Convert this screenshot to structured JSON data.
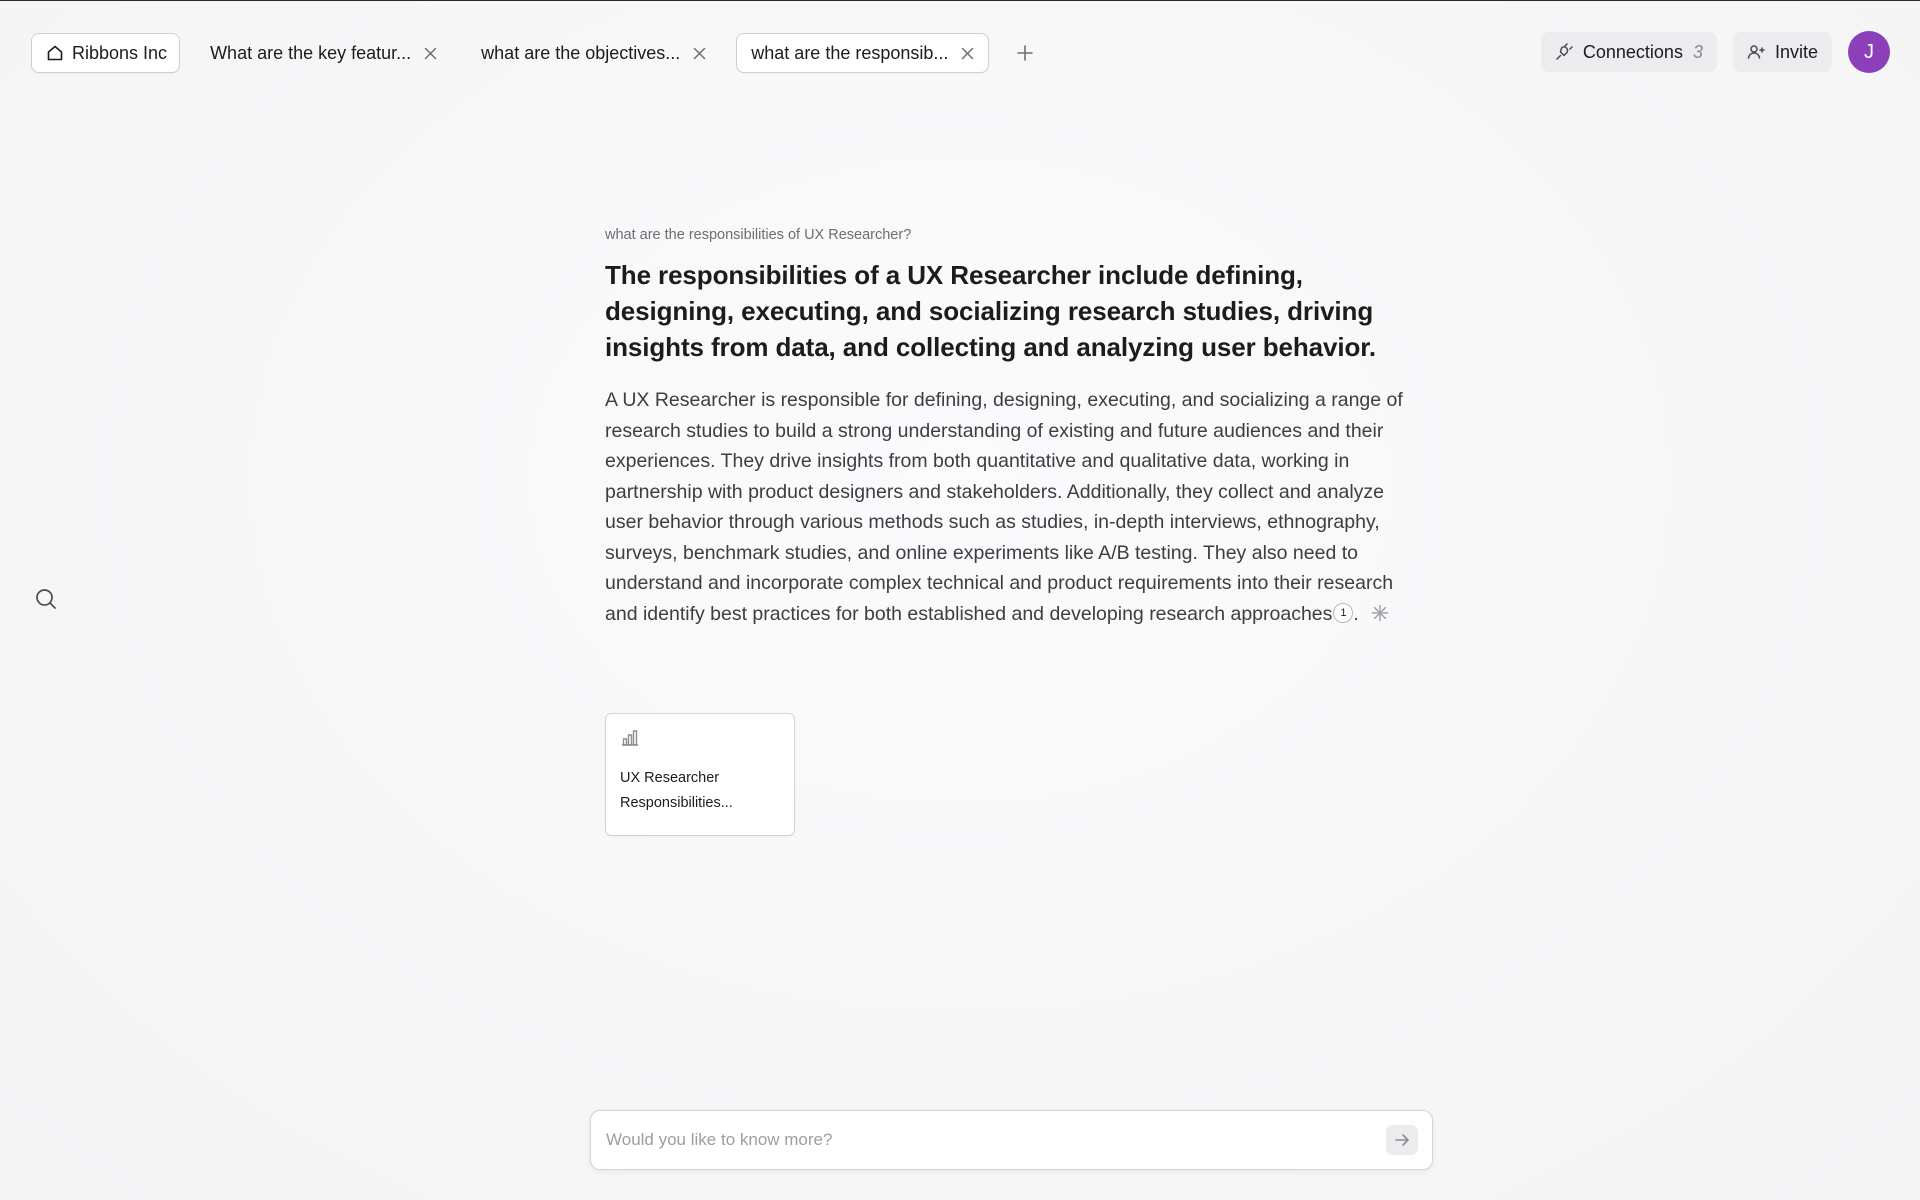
{
  "topbar": {
    "home_tab": {
      "label": "Ribbons Inc",
      "icon": "home-icon"
    },
    "tabs": [
      {
        "label": "What are the key featur...",
        "active": false
      },
      {
        "label": "what are the objectives...",
        "active": false
      },
      {
        "label": "what are the responsib...",
        "active": true
      }
    ],
    "new_tab_icon": "plus-icon",
    "connections": {
      "label": "Connections",
      "count": "3",
      "icon": "plug-icon"
    },
    "invite": {
      "label": "Invite",
      "icon": "user-plus-icon"
    },
    "avatar": {
      "initial": "J",
      "color": "#8b3fb8"
    }
  },
  "sidebar": {
    "search_icon": "search-icon"
  },
  "answer": {
    "question": "what are the responsibilities of UX Researcher?",
    "headline": "The responsibilities of a UX Researcher include defining, designing, executing, and socializing research studies, driving insights from data, and collecting and analyzing user behavior.",
    "body": "A UX Researcher is responsible for defining, designing, executing, and socializing a range of research studies to build a strong understanding of existing and future audiences and their experiences. They drive insights from both quantitative and qualitative data, working in partnership with product designers and stakeholders. Additionally, they collect and analyze user behavior through various methods such as studies, in-depth interviews, ethnography, surveys, benchmark studies, and online experiments like A/B testing. They also need to understand and incorporate complex technical and product requirements into their research and identify best practices for both established and developing research approaches",
    "citation": "1",
    "trailing": "."
  },
  "source_card": {
    "icon": "bar-chart-icon",
    "title": "UX Researcher Responsibilities..."
  },
  "ask": {
    "placeholder": "Would you like to know more?",
    "value": "",
    "send_icon": "arrow-right-icon"
  },
  "colors": {
    "accent": "#8b3fb8",
    "background": "#f8f8f9"
  }
}
